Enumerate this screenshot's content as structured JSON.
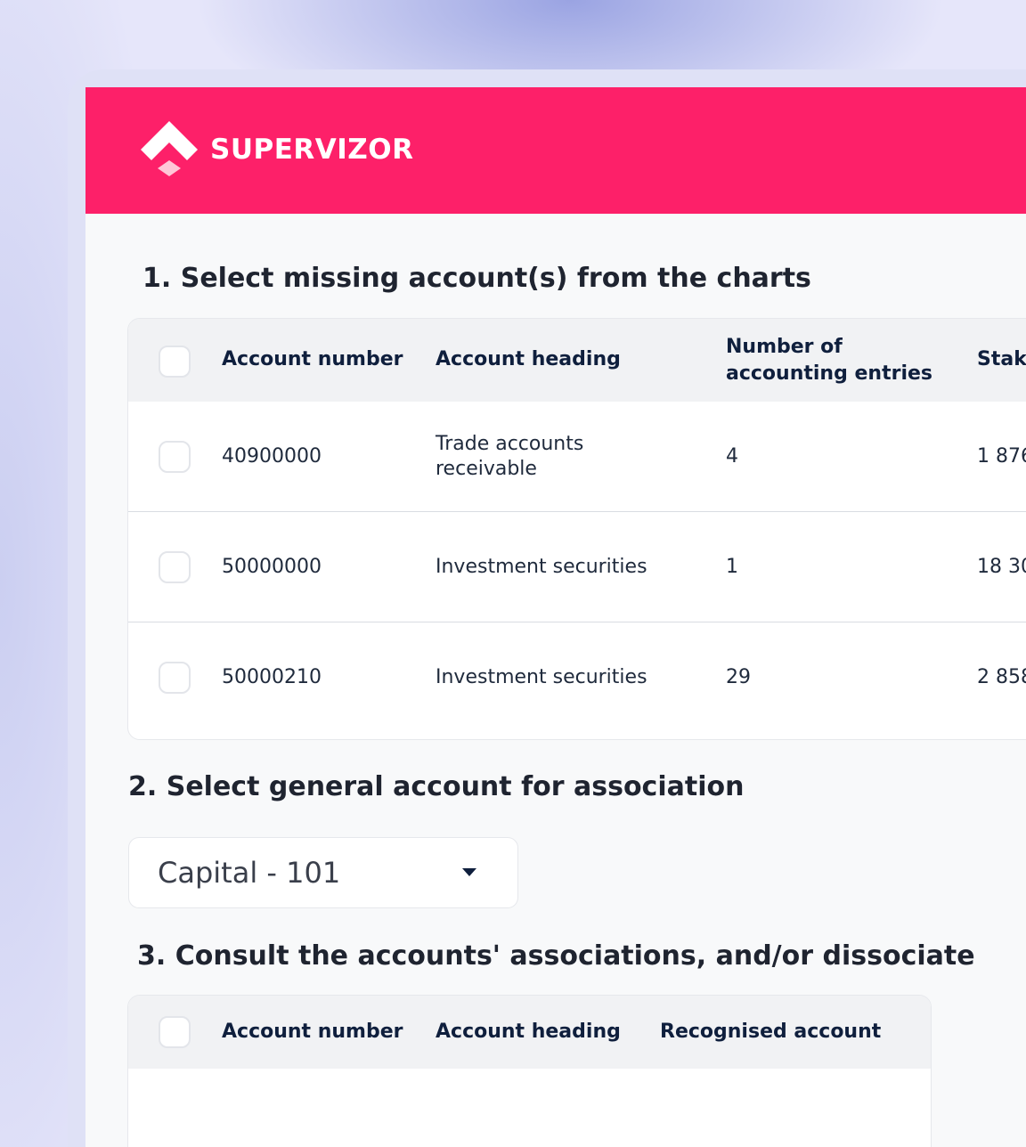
{
  "brand": {
    "name": "SUPERVIZOR",
    "header_color": "#fd2069"
  },
  "section1": {
    "title": "1. Select missing account(s) from the charts",
    "columns": [
      "Account number",
      "Account heading",
      "Number of accounting entries",
      "Stak"
    ],
    "rows": [
      {
        "account_number": "40900000",
        "heading": "Trade accounts receivable",
        "entries": "4",
        "stake": "1 876"
      },
      {
        "account_number": "50000000",
        "heading": "Investment securities",
        "entries": "1",
        "stake": "18 30"
      },
      {
        "account_number": "50000210",
        "heading": "Investment securities",
        "entries": "29",
        "stake": "2 858"
      }
    ]
  },
  "section2": {
    "title": "2. Select general account for association",
    "select_value": "Capital - 101"
  },
  "section3": {
    "title": "3. Consult the accounts' associations, and/or dissociate",
    "columns": [
      "Account number",
      "Account heading",
      "Recognised account"
    ]
  },
  "icons": {
    "logo": "supervizor-diamond-logo",
    "dropdown": "caret-down-icon"
  }
}
